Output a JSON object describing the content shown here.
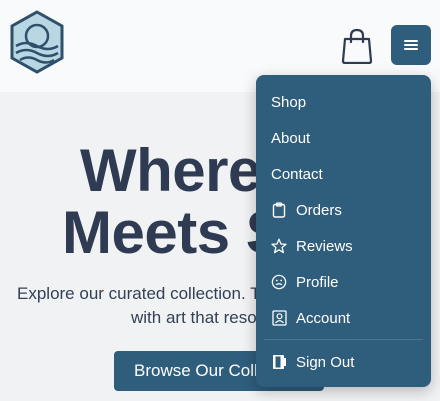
{
  "header": {
    "logo": "hexagon-landscape-logo",
    "cart_icon": "shopping-bag-icon",
    "menu_icon": "hamburger-icon"
  },
  "hero": {
    "title_line1": "Where Art",
    "title_line2": "Meets Soul",
    "subtitle_line1": "Explore our curated collection. Transform your space",
    "subtitle_line2": "with art that resonates.",
    "cta_label": "Browse Our Collection"
  },
  "menu": {
    "items": [
      {
        "label": "Shop",
        "icon": ""
      },
      {
        "label": "About",
        "icon": ""
      },
      {
        "label": "Contact",
        "icon": ""
      },
      {
        "label": "Orders",
        "icon": "clipboard-icon"
      },
      {
        "label": "Reviews",
        "icon": "star-icon"
      },
      {
        "label": "Profile",
        "icon": "smiley-icon"
      },
      {
        "label": "Account",
        "icon": "user-portrait-icon"
      },
      {
        "label": "Sign Out",
        "icon": "door-icon"
      }
    ]
  },
  "colors": {
    "primary": "#2f5d7c",
    "title": "#2f3b52",
    "background": "#f1f2f4",
    "header": "#f9fafb"
  }
}
